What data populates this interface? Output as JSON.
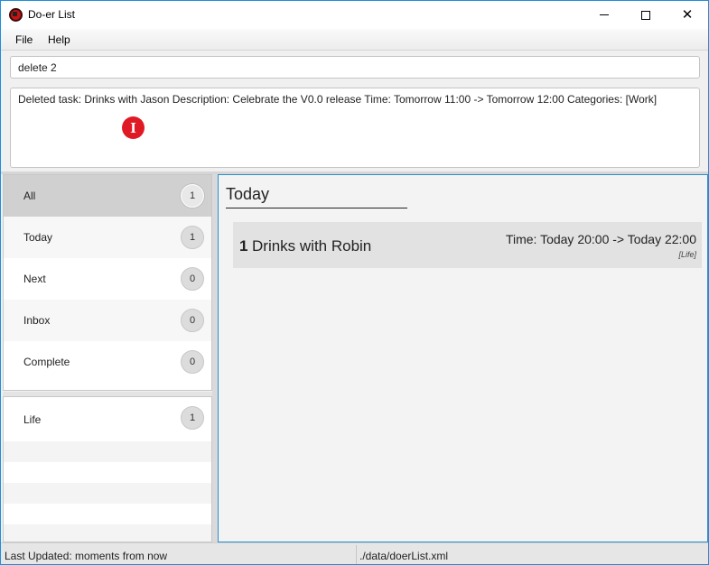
{
  "window": {
    "title": "Do-er List",
    "minimize": "—",
    "maximize": "☐",
    "close": "✕"
  },
  "menu": {
    "file": "File",
    "help": "Help"
  },
  "command": {
    "value": "delete 2"
  },
  "result": {
    "text": "Deleted task: Drinks with Jason Description: Celebrate the V0.0 release Time: Tomorrow 11:00 -> Tomorrow 12:00 Categories: [Work]",
    "cursor_glyph": "I"
  },
  "categories": [
    {
      "label": "All",
      "count": "1",
      "selected": true
    },
    {
      "label": "Today",
      "count": "1",
      "selected": false
    },
    {
      "label": "Next",
      "count": "0",
      "selected": false
    },
    {
      "label": "Inbox",
      "count": "0",
      "selected": false
    },
    {
      "label": "Complete",
      "count": "0",
      "selected": false
    }
  ],
  "tags": [
    {
      "label": "Life",
      "count": "1"
    }
  ],
  "main": {
    "section_title": "Today",
    "task": {
      "index": "1",
      "name": "Drinks with Robin",
      "time": "Time: Today 20:00 -> Today 22:00",
      "categories": "[Life]"
    }
  },
  "status": {
    "last_updated": "Last Updated: moments from now",
    "file_path": "./data/doerList.xml"
  },
  "colors": {
    "accent_border": "#2b8fd1",
    "selected_row": "#d0d0d0",
    "cursor_marker": "#e01a24"
  }
}
